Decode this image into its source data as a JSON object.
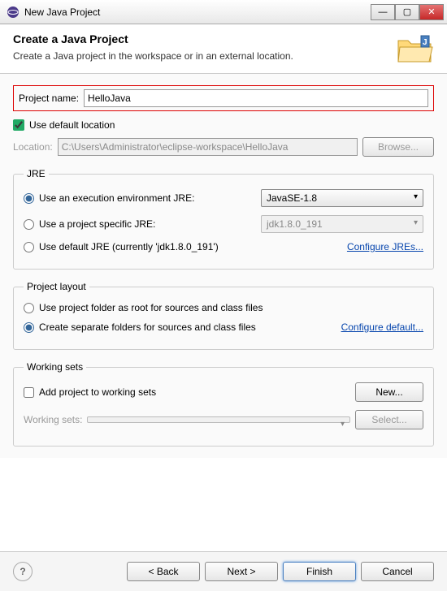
{
  "titlebar": {
    "title": "New Java Project"
  },
  "header": {
    "title": "Create a Java Project",
    "subtitle": "Create a Java project in the workspace or in an external location."
  },
  "project_name": {
    "label": "Project name:",
    "value": "HelloJava"
  },
  "use_default_location": {
    "label": "Use default location",
    "checked": true
  },
  "location": {
    "label": "Location:",
    "value": "C:\\Users\\Administrator\\eclipse-workspace\\HelloJava",
    "browse": "Browse..."
  },
  "jre": {
    "legend": "JRE",
    "opt_env": "Use an execution environment JRE:",
    "env_value": "JavaSE-1.8",
    "opt_specific": "Use a project specific JRE:",
    "specific_value": "jdk1.8.0_191",
    "opt_default": "Use default JRE (currently 'jdk1.8.0_191')",
    "configure": "Configure JREs..."
  },
  "layout": {
    "legend": "Project layout",
    "opt_root": "Use project folder as root for sources and class files",
    "opt_separate": "Create separate folders for sources and class files",
    "configure": "Configure default..."
  },
  "working_sets": {
    "legend": "Working sets",
    "add_label": "Add project to working sets",
    "new_btn": "New...",
    "ws_label": "Working sets:",
    "select_btn": "Select..."
  },
  "buttons": {
    "back": "< Back",
    "next": "Next >",
    "finish": "Finish",
    "cancel": "Cancel"
  }
}
